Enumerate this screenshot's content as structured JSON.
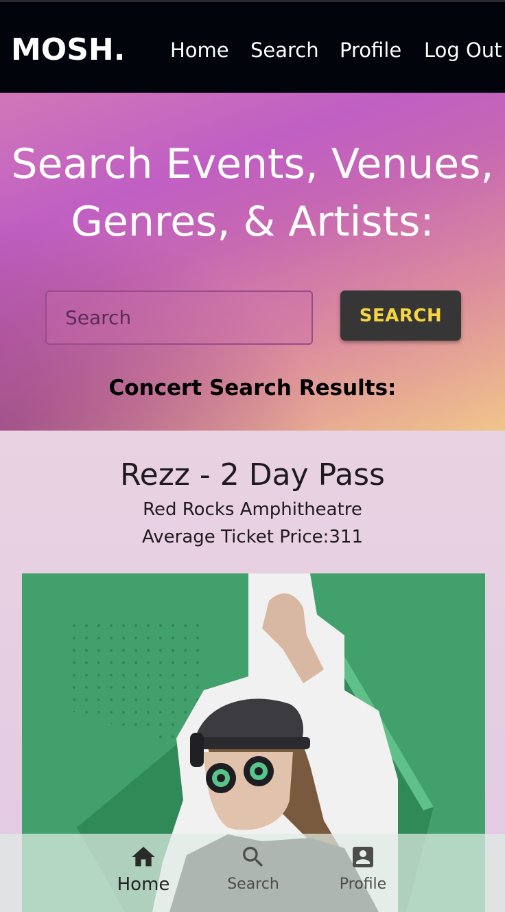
{
  "nav": {
    "logo": "MOSH.",
    "links": [
      "Home",
      "Search",
      "Profile",
      "Log Out"
    ]
  },
  "hero": {
    "title_line1": "Search Events, Venues,",
    "title_line2": "Genres, & Artists:",
    "search_placeholder": "Search",
    "search_button": "SEARCH",
    "results_heading": "Concert Search Results:"
  },
  "event": {
    "title": "Rezz - 2 Day Pass",
    "venue": "Red Rocks Amphitheatre",
    "price_label": "Average Ticket Price:311"
  },
  "bottom_nav": {
    "items": [
      {
        "label": "Home",
        "icon": "home-icon"
      },
      {
        "label": "Search",
        "icon": "search-icon"
      },
      {
        "label": "Profile",
        "icon": "account-box-icon"
      }
    ]
  },
  "colors": {
    "topbar": "#02040c",
    "search_button_bg": "#363636",
    "search_button_text": "#f7d53f",
    "image_green": "#42a06c"
  }
}
